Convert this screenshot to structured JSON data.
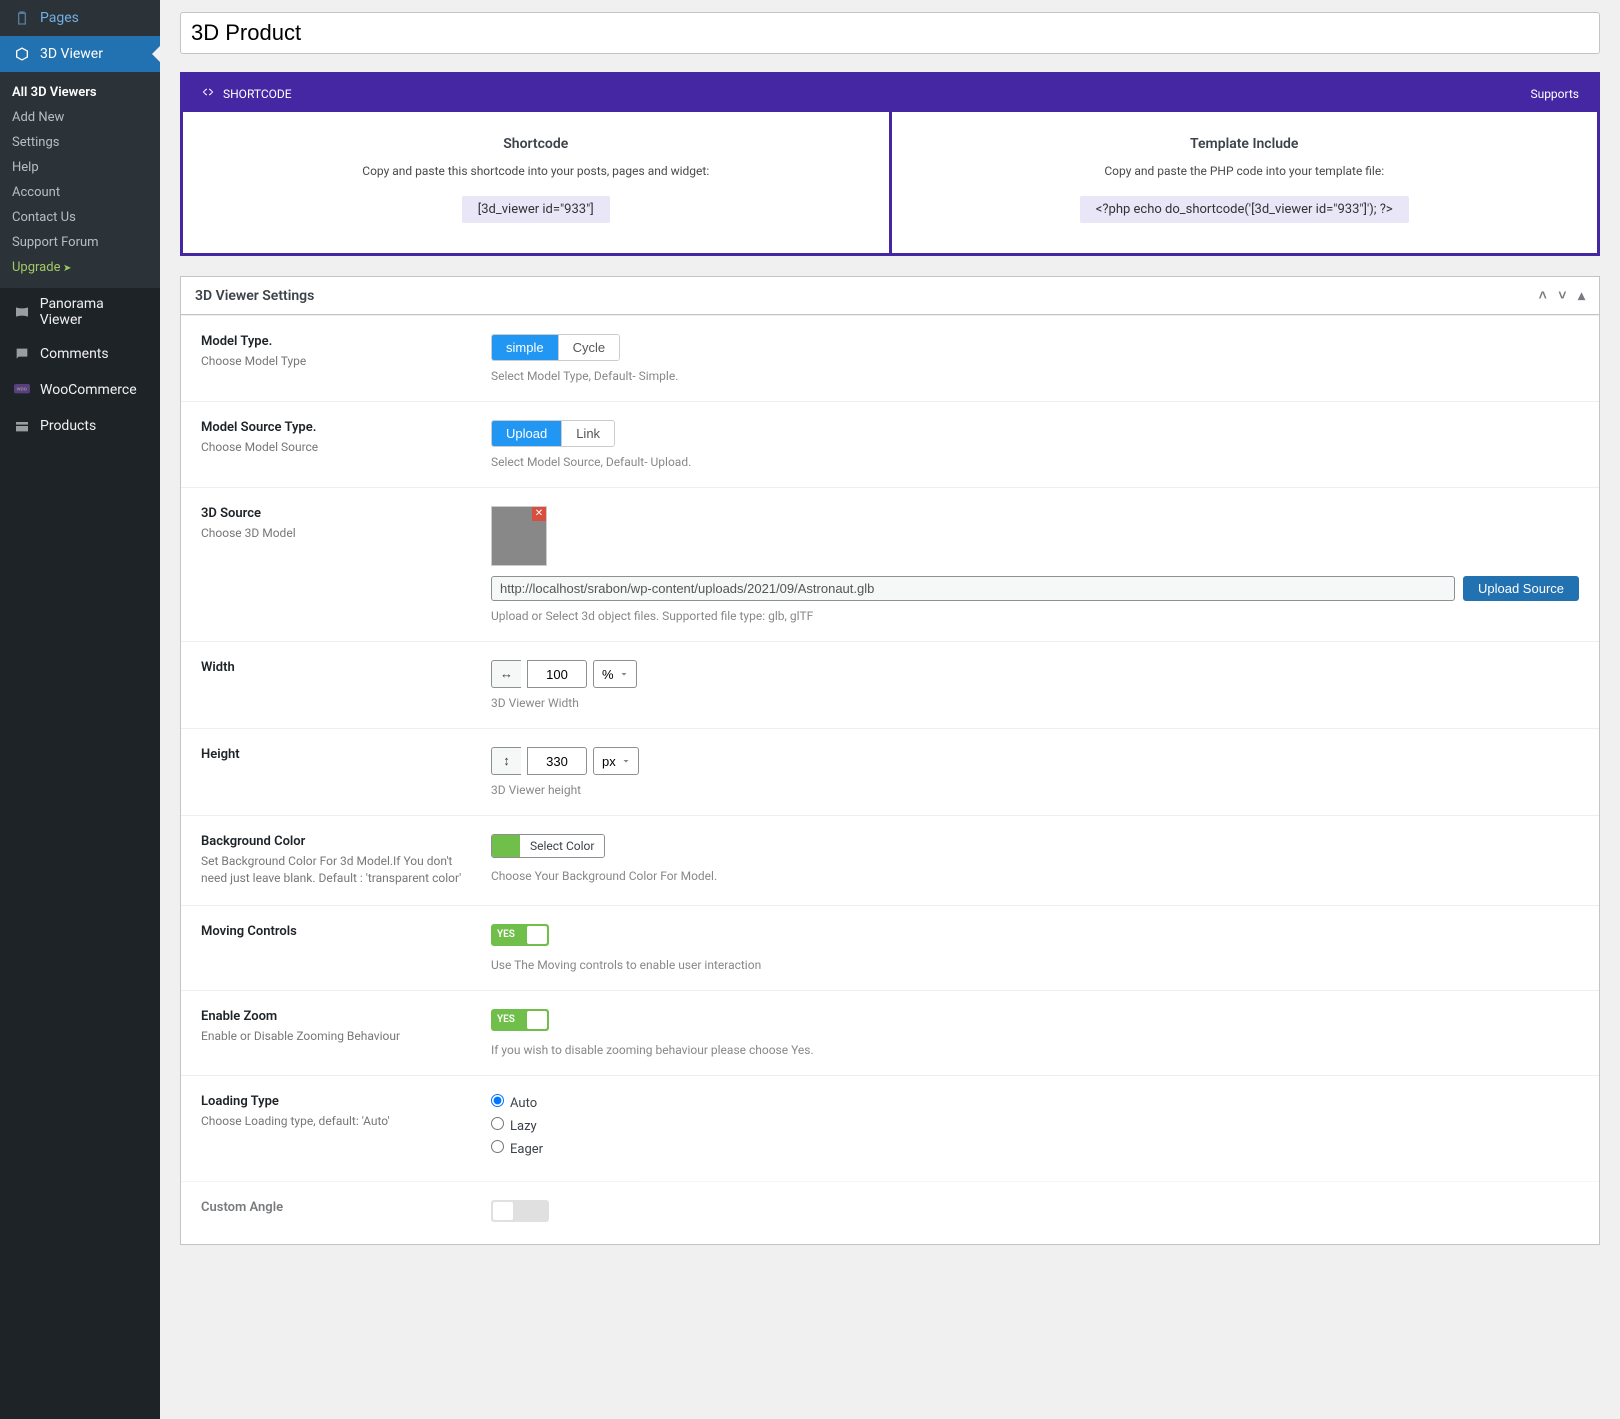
{
  "sidebar": {
    "items": [
      {
        "icon": "pages-icon",
        "label": "Pages"
      },
      {
        "icon": "cube-icon",
        "label": "3D Viewer",
        "active": true
      },
      {
        "icon": "panorama-icon",
        "label": "Panorama Viewer"
      },
      {
        "icon": "comments-icon",
        "label": "Comments"
      },
      {
        "icon": "woo-icon",
        "label": "WooCommerce"
      },
      {
        "icon": "products-icon",
        "label": "Products"
      }
    ],
    "subitems": [
      {
        "label": "All 3D Viewers",
        "highlighted": true
      },
      {
        "label": "Add New"
      },
      {
        "label": "Settings"
      },
      {
        "label": "Help"
      },
      {
        "label": "Account"
      },
      {
        "label": "Contact Us"
      },
      {
        "label": "Support Forum"
      },
      {
        "label": "Upgrade",
        "upgrade": true
      }
    ]
  },
  "title": "3D Product",
  "shortcode_panel": {
    "header_label": "SHORTCODE",
    "supports_label": "Supports",
    "shortcode_title": "Shortcode",
    "shortcode_desc": "Copy and paste this shortcode into your posts, pages and widget:",
    "shortcode_code": "[3d_viewer id=\"933\"]",
    "template_title": "Template Include",
    "template_desc": "Copy and paste the PHP code into your template file:",
    "template_code": "<?php echo do_shortcode('[3d_viewer id=\"933\"]'); ?>"
  },
  "settings_panel": {
    "title": "3D Viewer Settings",
    "rows": {
      "model_type": {
        "label": "Model Type.",
        "sub": "Choose Model Type",
        "options": [
          "simple",
          "Cycle"
        ],
        "active": "simple",
        "help": "Select Model Type, Default- Simple."
      },
      "model_source_type": {
        "label": "Model Source Type.",
        "sub": "Choose Model Source",
        "options": [
          "Upload",
          "Link"
        ],
        "active": "Upload",
        "help": "Select Model Source, Default- Upload."
      },
      "three_d_source": {
        "label": "3D Source",
        "sub": "Choose 3D Model",
        "url": "http://localhost/srabon/wp-content/uploads/2021/09/Astronaut.glb",
        "button": "Upload Source",
        "help": "Upload or Select 3d object files. Supported file type: glb, glTF"
      },
      "width": {
        "label": "Width",
        "value": "100",
        "unit": "%",
        "help": "3D Viewer Width"
      },
      "height": {
        "label": "Height",
        "value": "330",
        "unit": "px",
        "help": "3D Viewer height"
      },
      "background_color": {
        "label": "Background Color",
        "sub": "Set Background Color For 3d Model.If You don't need just leave blank. Default : 'transparent color'",
        "button": "Select Color",
        "help": "Choose Your Background Color For Model.",
        "swatch": "#6fbf4a"
      },
      "moving_controls": {
        "label": "Moving Controls",
        "toggle": "YES",
        "help": "Use The Moving controls to enable user interaction"
      },
      "enable_zoom": {
        "label": "Enable Zoom",
        "sub": "Enable or Disable Zooming Behaviour",
        "toggle": "YES",
        "help": "If you wish to disable zooming behaviour please choose Yes."
      },
      "loading_type": {
        "label": "Loading Type",
        "sub": "Choose Loading type, default: 'Auto'",
        "options": [
          "Auto",
          "Lazy",
          "Eager"
        ],
        "selected": "Auto"
      },
      "custom_angle": {
        "label": "Custom Angle"
      }
    }
  }
}
